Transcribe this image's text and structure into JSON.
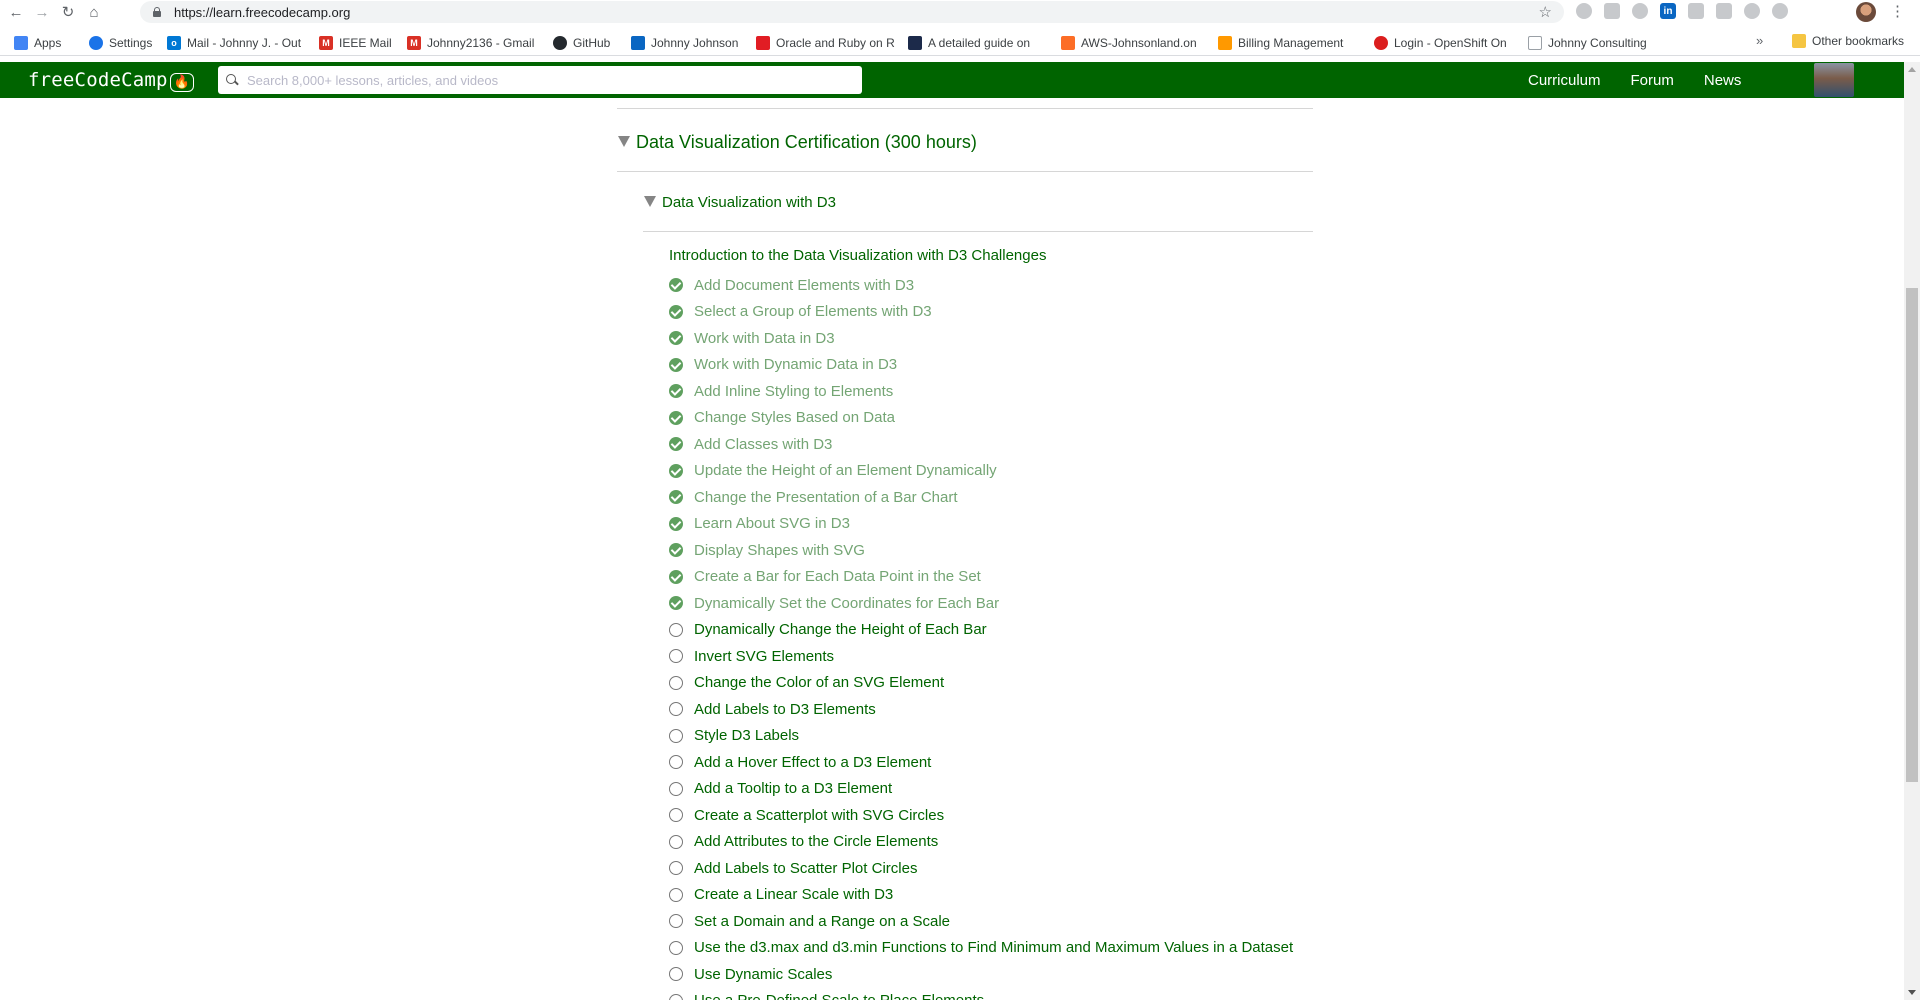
{
  "browser": {
    "url": "https://learn.freecodecamp.org",
    "nav_icons": [
      "back-icon",
      "forward-icon",
      "reload-icon",
      "home-icon"
    ],
    "bookmarks": [
      {
        "label": "Apps",
        "icon": "apps-grid-icon",
        "color": "#4285f4"
      },
      {
        "label": "Settings",
        "icon": "gear-icon",
        "color": "#1a73e8"
      },
      {
        "label": "Mail - Johnny J. - Out",
        "icon": "outlook-icon",
        "color": "#0078d4"
      },
      {
        "label": "IEEE Mail",
        "icon": "gmail-icon",
        "color": "#d93025"
      },
      {
        "label": "Johnny2136 - Gmail",
        "icon": "gmail-icon",
        "color": "#d93025"
      },
      {
        "label": "GitHub",
        "icon": "github-icon",
        "color": "#24292e"
      },
      {
        "label": "Johnny Johnson",
        "icon": "profile-card-icon",
        "color": "#0a66c2"
      },
      {
        "label": "Oracle and Ruby on R",
        "icon": "oracle-icon",
        "color": "#e11d24"
      },
      {
        "label": "A detailed guide on",
        "icon": "bookmark-icon",
        "color": "#1c2a4a"
      },
      {
        "label": "AWS-Johnsonland.on",
        "icon": "gitlab-icon",
        "color": "#fc6d26"
      },
      {
        "label": "Billing Management",
        "icon": "aws-icon",
        "color": "#ff9900"
      },
      {
        "label": "Login - OpenShift On",
        "icon": "openshift-icon",
        "color": "#db1e1e"
      },
      {
        "label": "Johnny Consulting",
        "icon": "page-icon",
        "color": "#9aa0a6"
      }
    ],
    "more_bookmarks_label": "»",
    "other_bookmarks_label": "Other bookmarks"
  },
  "fcc_nav": {
    "logo_text": "freeCodeCamp",
    "logo_flame": "(🔥)",
    "search_placeholder": "Search 8,000+ lessons, articles, and videos",
    "links": [
      "Curriculum",
      "Forum",
      "News"
    ]
  },
  "content": {
    "cert_title": "Data Visualization Certification (300 hours)",
    "block_title": "Data Visualization with D3",
    "intro": "Introduction to the Data Visualization with D3 Challenges",
    "challenges": [
      {
        "title": "Add Document Elements with D3",
        "completed": true
      },
      {
        "title": "Select a Group of Elements with D3",
        "completed": true
      },
      {
        "title": "Work with Data in D3",
        "completed": true
      },
      {
        "title": "Work with Dynamic Data in D3",
        "completed": true
      },
      {
        "title": "Add Inline Styling to Elements",
        "completed": true
      },
      {
        "title": "Change Styles Based on Data",
        "completed": true
      },
      {
        "title": "Add Classes with D3",
        "completed": true
      },
      {
        "title": "Update the Height of an Element Dynamically",
        "completed": true
      },
      {
        "title": "Change the Presentation of a Bar Chart",
        "completed": true
      },
      {
        "title": "Learn About SVG in D3",
        "completed": true
      },
      {
        "title": "Display Shapes with SVG",
        "completed": true
      },
      {
        "title": "Create a Bar for Each Data Point in the Set",
        "completed": true
      },
      {
        "title": "Dynamically Set the Coordinates for Each Bar",
        "completed": true
      },
      {
        "title": "Dynamically Change the Height of Each Bar",
        "completed": false
      },
      {
        "title": "Invert SVG Elements",
        "completed": false
      },
      {
        "title": "Change the Color of an SVG Element",
        "completed": false
      },
      {
        "title": "Add Labels to D3 Elements",
        "completed": false
      },
      {
        "title": "Style D3 Labels",
        "completed": false
      },
      {
        "title": "Add a Hover Effect to a D3 Element",
        "completed": false
      },
      {
        "title": "Add a Tooltip to a D3 Element",
        "completed": false
      },
      {
        "title": "Create a Scatterplot with SVG Circles",
        "completed": false
      },
      {
        "title": "Add Attributes to the Circle Elements",
        "completed": false
      },
      {
        "title": "Add Labels to Scatter Plot Circles",
        "completed": false
      },
      {
        "title": "Create a Linear Scale with D3",
        "completed": false
      },
      {
        "title": "Set a Domain and a Range on a Scale",
        "completed": false
      },
      {
        "title": "Use the d3.max and d3.min Functions to Find Minimum and Maximum Values in a Dataset",
        "completed": false
      },
      {
        "title": "Use Dynamic Scales",
        "completed": false
      },
      {
        "title": "Use a Pre-Defined Scale to Place Elements",
        "completed": false
      }
    ]
  }
}
